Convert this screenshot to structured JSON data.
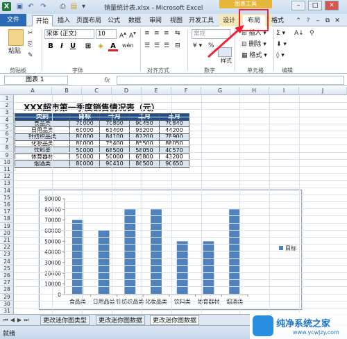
{
  "window": {
    "title": "销量统计表.xlsx - Microsoft Excel",
    "context_tool": "图表工具",
    "controls": [
      "–",
      "□",
      "✕"
    ]
  },
  "tabs": [
    "文件",
    "开始",
    "插入",
    "页面布局",
    "公式",
    "数据",
    "审阅",
    "视图",
    "开发工具",
    "设计",
    "布局",
    "格式"
  ],
  "ribbon": {
    "font_name": "宋体 (正文)",
    "font_size": "10",
    "number_format": "常规",
    "paste_label": "粘贴",
    "style_label": "样式",
    "insert_label": "插入",
    "delete_label": "删除",
    "format_label": "格式",
    "groups": [
      "剪贴板",
      "字体",
      "对齐方式",
      "数字",
      "单元格",
      "编辑"
    ],
    "bold": "B",
    "italic": "I",
    "underline": "U",
    "font_color": "A",
    "wen": "wén"
  },
  "formula_bar": {
    "name_box": "图表 1",
    "fx": "fx"
  },
  "columns": [
    "A",
    "B",
    "C",
    "D",
    "E",
    "F",
    "G",
    "H",
    "I",
    "J"
  ],
  "rows": [
    "1",
    "2",
    "3",
    "4",
    "5",
    "6",
    "7",
    "8",
    "9",
    "10",
    "11",
    "12",
    "13",
    "14",
    "15",
    "16",
    "17",
    "18",
    "19",
    "20",
    "21",
    "22",
    "23",
    "24",
    "25",
    "26",
    "27",
    "28",
    "29",
    "30",
    "31"
  ],
  "sheet": {
    "title": "XXX超市第一季度销售情况表（元）",
    "header": [
      "类别",
      "目标",
      "一月",
      "二月",
      "三月"
    ],
    "rows": [
      [
        "食品类",
        "70000",
        "70800",
        "90450",
        "70840"
      ],
      [
        "日用品类",
        "60000",
        "61400",
        "93200",
        "44200"
      ],
      [
        "针纺织品类",
        "80000",
        "84100",
        "87200",
        "78900"
      ],
      [
        "化妆品类",
        "80000",
        "75400",
        "85500",
        "88050"
      ],
      [
        "饮料类",
        "50000",
        "68500",
        "58050",
        "40570"
      ],
      [
        "体育器材",
        "50000",
        "50000",
        "65800",
        "43200"
      ],
      [
        "烟酒类",
        "80000",
        "90410",
        "86500",
        "90650"
      ]
    ]
  },
  "chart_data": {
    "type": "bar",
    "categories": [
      "食品类",
      "日用品类",
      "针纺织品类",
      "化妆品类",
      "饮料类",
      "体育器材",
      "烟酒类"
    ],
    "series": [
      {
        "name": "目标",
        "values": [
          70000,
          60000,
          80000,
          80000,
          50000,
          50000,
          80000
        ],
        "color": "#4f81bd"
      }
    ],
    "ylim": [
      0,
      90000
    ],
    "yticks": [
      0,
      10000,
      20000,
      30000,
      40000,
      50000,
      60000,
      70000,
      80000,
      90000
    ],
    "grid": false,
    "legend": "right"
  },
  "sheet_tabs": [
    "更改迷你图类型",
    "更改迷你图数据",
    "更改迷你图数据"
  ],
  "status": "就绪",
  "watermark": {
    "name": "纯净系统之家",
    "url": "www.ycwjzy.com"
  }
}
